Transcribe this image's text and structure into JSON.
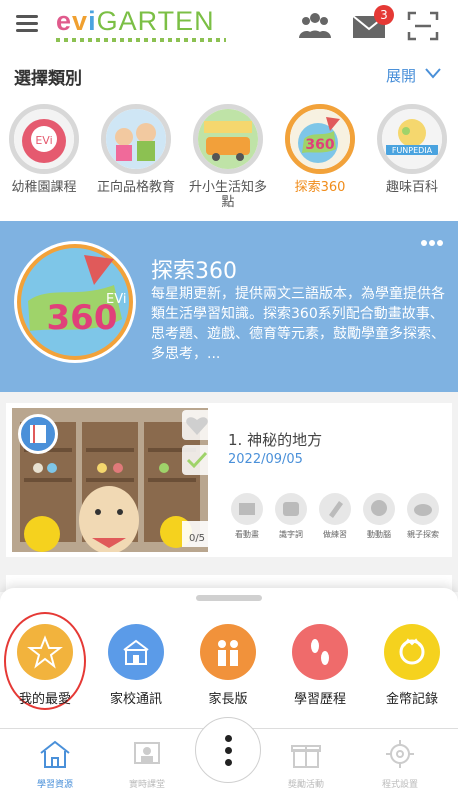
{
  "header": {
    "logo_text_e": "e",
    "logo_text_v": "v",
    "logo_text_i": "i",
    "logo_text_rest": "GARTEN",
    "mail_badge": "3"
  },
  "category": {
    "title": "選擇類別",
    "expand_label": "展開",
    "items": [
      {
        "label": "幼稚園課程",
        "icon": "evi-kindergarten-icon",
        "active": false
      },
      {
        "label": "正向品格教育",
        "icon": "character-education-icon",
        "active": false
      },
      {
        "label": "升小生活知多點",
        "icon": "first-day-school-icon",
        "active": false
      },
      {
        "label": "探索360",
        "icon": "explore-360-icon",
        "active": true
      },
      {
        "label": "趣味百科",
        "icon": "funpedia-icon",
        "active": false
      }
    ]
  },
  "banner": {
    "title": "探索360",
    "description": "每星期更新，提供兩文三語版本，為學童提供各類生活學習知識。探索360系列配合動畫故事、思考題、遊戲、德育等元素，鼓勵學童多探索、多思考，..."
  },
  "lesson": {
    "title": "1. 神秘的地方",
    "date": "2022/09/05",
    "progress": "0/5",
    "actions": [
      {
        "label": "看動畫",
        "icon": "video-icon"
      },
      {
        "label": "識字詞",
        "icon": "abc-icon"
      },
      {
        "label": "做練習",
        "icon": "pencil-icon"
      },
      {
        "label": "動動腦",
        "icon": "brain-icon"
      },
      {
        "label": "親子探索",
        "icon": "cloud-upload-icon"
      }
    ]
  },
  "quick_actions": [
    {
      "label": "我的最愛",
      "icon": "star-icon",
      "color": "#f2b33d"
    },
    {
      "label": "家校通訊",
      "icon": "school-icon",
      "color": "#5b9be8"
    },
    {
      "label": "家長版",
      "icon": "parents-icon",
      "color": "#f1923b"
    },
    {
      "label": "學習歷程",
      "icon": "footprints-icon",
      "color": "#ef6b6b"
    },
    {
      "label": "金幣記錄",
      "icon": "coin-icon",
      "color": "#f5d21e"
    }
  ],
  "tabs": [
    {
      "label": "學習資源",
      "icon": "home-icon",
      "active": true
    },
    {
      "label": "實時課堂",
      "icon": "live-class-icon",
      "active": false
    },
    {
      "label": "獎勵活動",
      "icon": "gift-icon",
      "active": false
    },
    {
      "label": "程式設置",
      "icon": "gear-icon",
      "active": false
    }
  ]
}
